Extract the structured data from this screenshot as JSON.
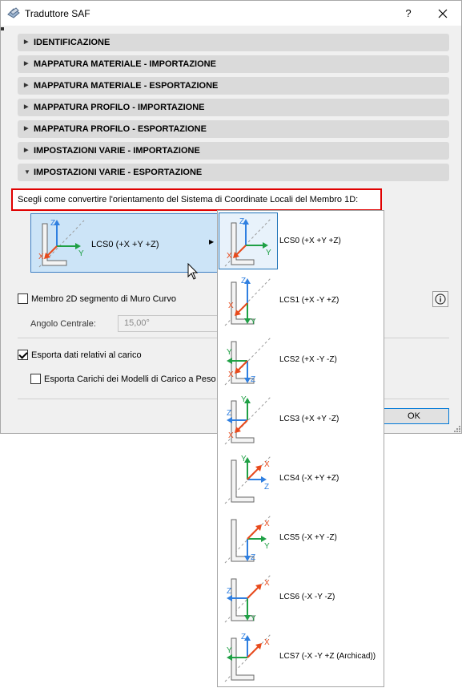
{
  "window": {
    "title": "Traduttore SAF",
    "help_label": "?"
  },
  "sections": [
    {
      "label": "IDENTIFICAZIONE",
      "expanded": false
    },
    {
      "label": "MAPPATURA MATERIALE - IMPORTAZIONE",
      "expanded": false
    },
    {
      "label": "MAPPATURA MATERIALE - ESPORTAZIONE",
      "expanded": false
    },
    {
      "label": "MAPPATURA PROFILO - IMPORTAZIONE",
      "expanded": false
    },
    {
      "label": "MAPPATURA PROFILO - ESPORTAZIONE",
      "expanded": false
    },
    {
      "label": "IMPOSTAZIONI VARIE - IMPORTAZIONE",
      "expanded": false
    },
    {
      "label": "IMPOSTAZIONI VARIE - ESPORTAZIONE",
      "expanded": true
    }
  ],
  "export": {
    "question": "Scegli come convertire l'orientamento del Sistema di Coordinate Locali del Membro 1D:",
    "selected_lcs": "LCS0 (+X +Y +Z)",
    "curved_wall": {
      "label": "Membro 2D segmento di Muro Curvo",
      "checked": false
    },
    "central_angle": {
      "label": "Angolo Centrale:",
      "value": "15,00°"
    },
    "load_data": {
      "label": "Esporta dati relativi al carico",
      "checked": true
    },
    "load_models": {
      "label": "Esporta Carichi dei Modelli di Carico a Peso",
      "checked": false
    }
  },
  "ok_label": "OK",
  "axis_letters": {
    "x": "X",
    "y": "Y",
    "z": "Z"
  },
  "colors": {
    "x_axis": "#e84a1c",
    "y_axis": "#1fa045",
    "z_axis": "#2f7fe0",
    "highlight": "#e00000",
    "selection": "#cce4f7"
  },
  "icons": {
    "info": "info-icon",
    "close": "close-icon",
    "app": "app-icon",
    "cursor": "mouse-pointer-icon"
  },
  "lcs_options": [
    {
      "label": "LCS0 (+X +Y +Z)",
      "selected": true
    },
    {
      "label": "LCS1 (+X -Y +Z)",
      "selected": false
    },
    {
      "label": "LCS2 (+X -Y -Z)",
      "selected": false
    },
    {
      "label": "LCS3 (+X +Y -Z)",
      "selected": false
    },
    {
      "label": "LCS4 (-X +Y +Z)",
      "selected": false
    },
    {
      "label": "LCS5 (-X +Y -Z)",
      "selected": false
    },
    {
      "label": "LCS6 (-X -Y -Z)",
      "selected": false
    },
    {
      "label": "LCS7 (-X -Y +Z (Archicad))",
      "selected": false
    }
  ]
}
